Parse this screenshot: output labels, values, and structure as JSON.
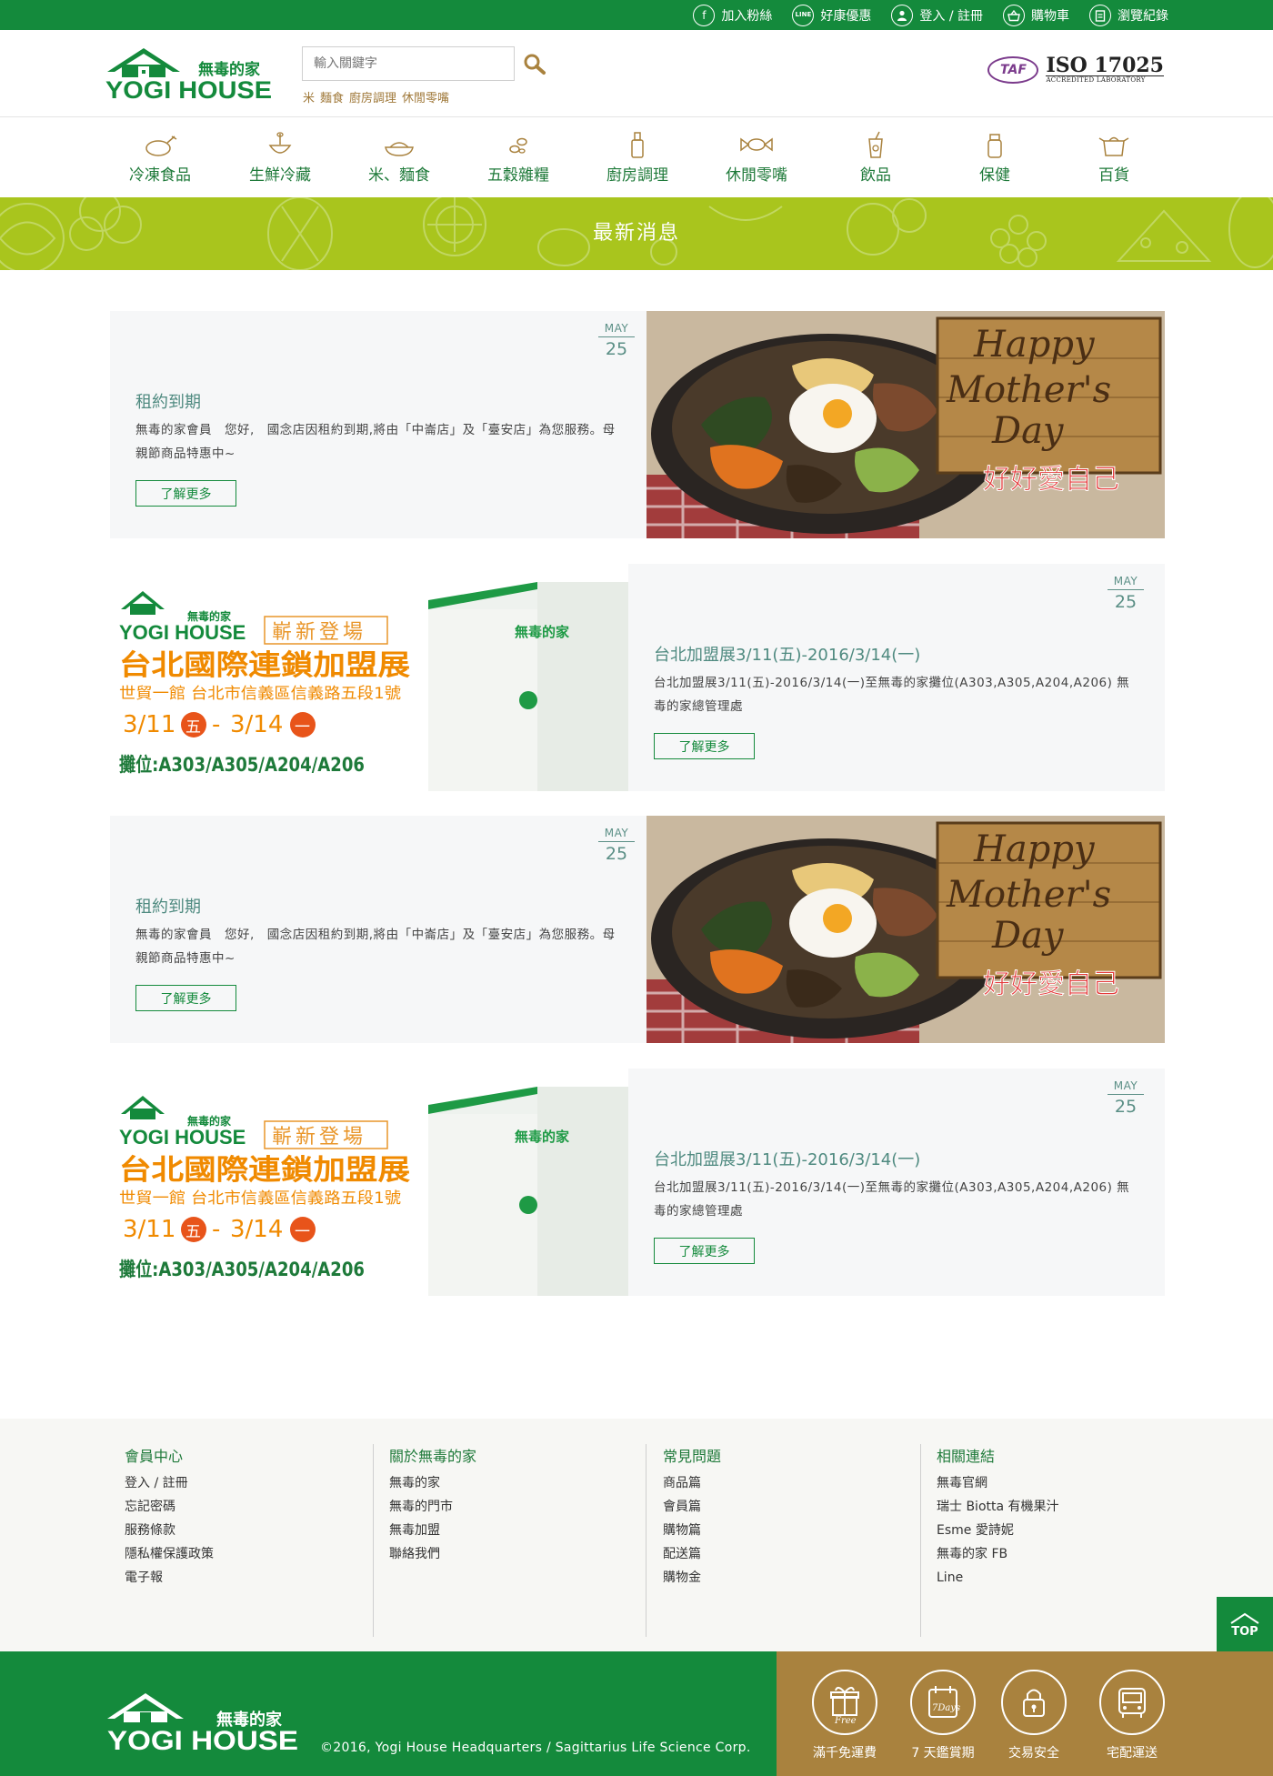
{
  "topbar": {
    "links": [
      {
        "label": "加入粉絲",
        "icon": "facebook-icon"
      },
      {
        "label": "好康優惠",
        "icon": "line-icon"
      },
      {
        "label": "登入 / 註冊",
        "icon": "user-icon"
      },
      {
        "label": "購物車",
        "icon": "basket-icon"
      },
      {
        "label": "瀏覽紀錄",
        "icon": "clipboard-icon"
      }
    ],
    "line_icon_text": "LINE"
  },
  "header": {
    "logo_cn": "無毒的家",
    "logo_en": "YOGI HOUSE",
    "search_placeholder": "輸入關鍵字",
    "hot_tags": [
      "米",
      "麵食",
      "廚房調理",
      "休閒零嘴"
    ],
    "taf": "TAF",
    "iso_title": "ISO 17025",
    "iso_sub": "ACCREDITED LABORATORY"
  },
  "categories": [
    {
      "label": "冷凍食品",
      "icon": "chicken-icon"
    },
    {
      "label": "生鮮冷藏",
      "icon": "bowl-spoon-icon"
    },
    {
      "label": "米、麵食",
      "icon": "rice-icon"
    },
    {
      "label": "五穀雜糧",
      "icon": "grain-icon"
    },
    {
      "label": "廚房調理",
      "icon": "bottle-icon"
    },
    {
      "label": "休閒零嘴",
      "icon": "candy-icon"
    },
    {
      "label": "飲品",
      "icon": "drink-icon"
    },
    {
      "label": "保健",
      "icon": "jar-icon"
    },
    {
      "label": "百貨",
      "icon": "pot-icon"
    }
  ],
  "banner": {
    "title": "最新消息"
  },
  "news": [
    {
      "month": "MAY",
      "day": "25",
      "title": "租約到期",
      "body": "無毒的家會員　您好,　國念店因租約到期,將由「中崙店」及「臺安店」為您服務。母親節商品特惠中~",
      "button": "了解更多",
      "image": "mothers-day"
    },
    {
      "month": "MAY",
      "day": "25",
      "title": "台北加盟展3/11(五)-2016/3/14(一)",
      "body": "台北加盟展3/11(五)-2016/3/14(一)至無毒的家攤位(A303,A305,A204,A206) 無毒的家總管理處",
      "button": "了解更多",
      "image": "franchise-expo"
    },
    {
      "month": "MAY",
      "day": "25",
      "title": "租約到期",
      "body": "無毒的家會員　您好,　國念店因租約到期,將由「中崙店」及「臺安店」為您服務。母親節商品特惠中~",
      "button": "了解更多",
      "image": "mothers-day"
    },
    {
      "month": "MAY",
      "day": "25",
      "title": "台北加盟展3/11(五)-2016/3/14(一)",
      "body": "台北加盟展3/11(五)-2016/3/14(一)至無毒的家攤位(A303,A305,A204,A206) 無毒的家總管理處",
      "button": "了解更多",
      "image": "franchise-expo"
    }
  ],
  "mothers_img": {
    "line1": "Happy",
    "line2": "Mother's",
    "line3": "Day",
    "cn": "好好愛自己"
  },
  "expo_img": {
    "logo_cn": "無毒的家",
    "logo_en": "YOGI HOUSE",
    "tag": "嶄新登場",
    "title": "台北國際連鎖加盟展",
    "venue": "世貿一館 台北市信義區信義路五段1號",
    "d1": "3/11",
    "w1": "五",
    "d2": "3/14",
    "w2": "一",
    "dash": "-",
    "booth": "攤位:A303/A305/A204/A206",
    "store_sign": "無毒的家"
  },
  "footer": {
    "columns": [
      {
        "title": "會員中心",
        "links": [
          "登入 / 註冊",
          "忘記密碼",
          "服務條款",
          "隱私權保護政策",
          "電子報"
        ]
      },
      {
        "title": "關於無毒的家",
        "links": [
          "無毒的家",
          "無毒的門市",
          "無毒加盟",
          "聯絡我們"
        ]
      },
      {
        "title": "常見問題",
        "links": [
          "商品篇",
          "會員篇",
          "購物篇",
          "配送篇",
          "購物金"
        ]
      },
      {
        "title": "相關連結",
        "links": [
          "無毒官網",
          "瑞士 Biotta 有機果汁",
          "Esme 愛詩妮",
          "無毒的家 FB",
          "Line"
        ]
      }
    ],
    "top_label": "TOP"
  },
  "bottom": {
    "logo_cn": "無毒的家",
    "logo_en": "YOGI HOUSE",
    "copyright": "©2016, Yogi House Headquarters / Sagittarius Life Science Corp.",
    "services": [
      {
        "label": "滿千免運費",
        "icon": "gift-free-icon",
        "badge": "Free"
      },
      {
        "label": "7 天鑑賞期",
        "icon": "calendar-7days-icon",
        "badge": "7Days"
      },
      {
        "label": "交易安全",
        "icon": "lock-icon",
        "badge": ""
      },
      {
        "label": "宅配運送",
        "icon": "bus-icon",
        "badge": ""
      }
    ]
  },
  "colors": {
    "brand_green": "#148a3c",
    "banner_green": "#a9c51d",
    "gold": "#a9823e",
    "teal_text": "#4f8a80"
  }
}
